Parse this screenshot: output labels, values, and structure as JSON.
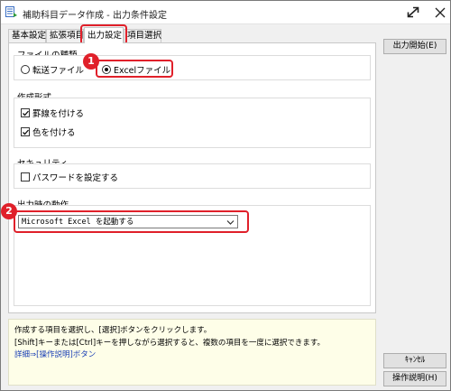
{
  "window": {
    "title": "補助科目データ作成 - 出力条件設定"
  },
  "tabs": [
    {
      "label": "基本設定"
    },
    {
      "label": "拡張項目"
    },
    {
      "label": "出力設定"
    },
    {
      "label": "項目選択"
    }
  ],
  "file_type": {
    "group_label": "ファイルの種類",
    "options": [
      {
        "label": "転送ファイル",
        "selected": false
      },
      {
        "label": "Excelファイル",
        "selected": true
      }
    ]
  },
  "format": {
    "group_label": "作成形式",
    "options": [
      {
        "label": "罫線を付ける",
        "checked": true
      },
      {
        "label": "色を付ける",
        "checked": true
      }
    ]
  },
  "security": {
    "group_label": "セキュリティ",
    "options": [
      {
        "label": "パスワードを設定する",
        "checked": false
      }
    ]
  },
  "output_action": {
    "group_label": "出力時の動作",
    "selected_value": "Microsoft Excel を起動する"
  },
  "markers": [
    "1",
    "2"
  ],
  "buttons": {
    "start_output": "出力開始(E)",
    "cancel": "ｷｬﾝｾﾙ",
    "help": "操作説明(H)"
  },
  "help_text": {
    "line1": "作成する項目を選択し、[選択]ボタンをクリックします。",
    "line2": "[Shift]キーまたは[Ctrl]キーを押しながら選択すると、複数の項目を一度に選択できます。",
    "line3": "詳細⇒[操作説明]ボタン"
  },
  "colors": {
    "highlight": "#e0202a",
    "help_background": "#fefee8",
    "link": "#1a3fb5"
  }
}
